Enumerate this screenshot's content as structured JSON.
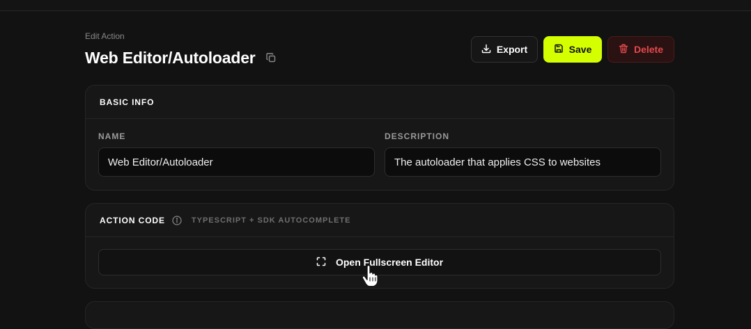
{
  "header": {
    "eyebrow": "Edit Action",
    "title": "Web Editor/Autoloader"
  },
  "actions": {
    "export_label": "Export",
    "save_label": "Save",
    "delete_label": "Delete"
  },
  "basic_info": {
    "section_title": "BASIC INFO",
    "name_label": "NAME",
    "name_value": "Web Editor/Autoloader",
    "description_label": "DESCRIPTION",
    "description_value": "The autoloader that applies CSS to websites"
  },
  "action_code": {
    "section_title": "ACTION CODE",
    "subtitle": "TYPESCRIPT + SDK AUTOCOMPLETE",
    "editor_button_label": "Open Fullscreen Editor"
  },
  "icons": {
    "copy": "copy-icon",
    "export": "download-icon",
    "save": "save-icon",
    "delete": "trash-icon",
    "info": "info-icon",
    "fullscreen": "fullscreen-icon",
    "cursor": "hand-pointer-icon"
  },
  "colors": {
    "background": "#121212",
    "card": "#171717",
    "accent": "#d4ff00",
    "danger": "#e5484d"
  }
}
